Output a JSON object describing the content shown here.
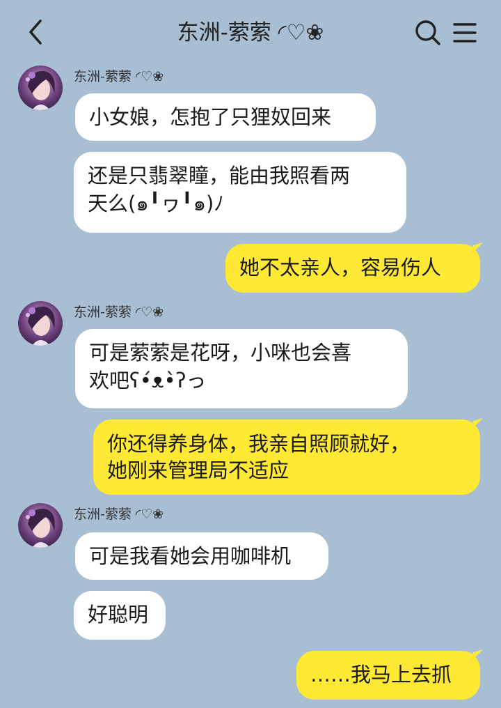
{
  "header": {
    "title": "东洲-萦萦 ◜♡❀"
  },
  "contact": {
    "name": "东洲-萦萦 ◜♡❀"
  },
  "messages": [
    {
      "side": "in",
      "text": "小女娘，怎抱了只狸奴回来"
    },
    {
      "side": "in",
      "lines": [
        "还是只翡翠瞳，能由我照看两",
        "天么(๑╹ヮ╹๑)ﾉ"
      ]
    },
    {
      "side": "out",
      "text": "她不太亲人，容易伤人"
    },
    {
      "side": "in",
      "lines": [
        "可是萦萦是花呀，小咪也会喜",
        "欢吧ʕ•́ᴥ•̀ʔっ"
      ]
    },
    {
      "side": "out",
      "lines": [
        "你还得养身体，我亲自照顾就好，",
        "她刚来管理局不适应"
      ]
    },
    {
      "side": "in",
      "text": "可是我看她会用咖啡机"
    },
    {
      "side": "in",
      "text": "好聪明"
    },
    {
      "side": "out",
      "text": "……我马上去抓"
    }
  ],
  "colors": {
    "background": "#a7bed3",
    "incoming_bubble": "#ffffff",
    "outgoing_bubble": "#ffe934"
  },
  "icons": [
    "back-arrow-icon",
    "search-icon",
    "menu-icon"
  ]
}
